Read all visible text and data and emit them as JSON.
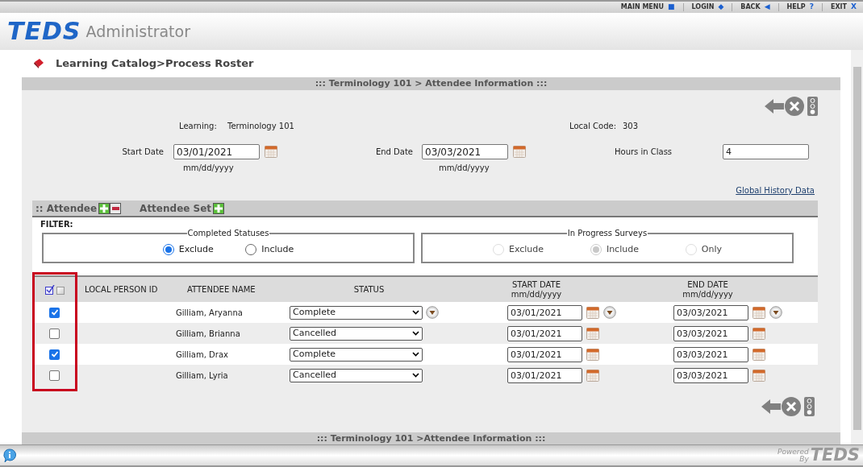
{
  "top_nav": [
    {
      "label": "MAIN MENU",
      "icon": "■"
    },
    {
      "label": "LOGIN",
      "icon": "◆"
    },
    {
      "label": "BACK",
      "icon": "◀"
    },
    {
      "label": "HELP",
      "icon": "?"
    },
    {
      "label": "EXIT",
      "icon": "X"
    }
  ],
  "header": {
    "logo": "TEDS",
    "app_name": "Administrator"
  },
  "breadcrumb": "Learning Catalog>Process Roster",
  "section_title": "::: Terminology 101 > Attendee Information :::",
  "info": {
    "learning_label": "Learning:",
    "learning": "Terminology 101",
    "local_code_label": "Local Code:",
    "local_code": "303"
  },
  "dates": {
    "start_label": "Start Date",
    "start": "03/01/2021",
    "start_hint": "mm/dd/yyyy",
    "end_label": "End Date",
    "end": "03/03/2021",
    "end_hint": "mm/dd/yyyy",
    "hours_label": "Hours in Class",
    "hours": "4"
  },
  "global_history_link": "Global History Data",
  "attendee_bar": {
    "attendee": ":: Attendee",
    "attendee_set": "Attendee Set"
  },
  "filter": {
    "label": "FILTER:",
    "groups": [
      {
        "legend": "Completed Statuses",
        "options": [
          {
            "label": "Exclude",
            "selected": true,
            "disabled": false
          },
          {
            "label": "Include",
            "selected": false,
            "disabled": false
          }
        ]
      },
      {
        "legend": "In Progress Surveys",
        "options": [
          {
            "label": "Exclude",
            "selected": false,
            "disabled": true
          },
          {
            "label": "Include",
            "selected": true,
            "disabled": true
          },
          {
            "label": "Only",
            "selected": false,
            "disabled": true
          }
        ]
      }
    ]
  },
  "table": {
    "checkbox_column_highlighted": true,
    "columns": [
      {
        "label": "LOCAL PERSON ID"
      },
      {
        "label": "ATTENDEE NAME"
      },
      {
        "label": "STATUS"
      },
      {
        "label": "START DATE",
        "hint": "mm/dd/yyyy"
      },
      {
        "label": "END DATE",
        "hint": "mm/dd/yyyy"
      }
    ],
    "rows": [
      {
        "checked": true,
        "name": "Gilliam, Aryanna",
        "status": "Complete",
        "start": "03/01/2021",
        "end": "03/03/2021",
        "copy_down": true
      },
      {
        "checked": false,
        "name": "Gilliam, Brianna",
        "status": "Cancelled",
        "start": "03/01/2021",
        "end": "03/03/2021",
        "copy_down": false
      },
      {
        "checked": true,
        "name": "Gilliam, Drax",
        "status": "Complete",
        "start": "03/01/2021",
        "end": "03/03/2021",
        "copy_down": false
      },
      {
        "checked": false,
        "name": "Gilliam, Lyria",
        "status": "Cancelled",
        "start": "03/01/2021",
        "end": "03/03/2021",
        "copy_down": false
      }
    ]
  },
  "footer_title": "::: Terminology 101 >Attendee Information :::",
  "status_bar": {
    "powered": "Powered",
    "by": "By",
    "logo": "TEDS"
  }
}
